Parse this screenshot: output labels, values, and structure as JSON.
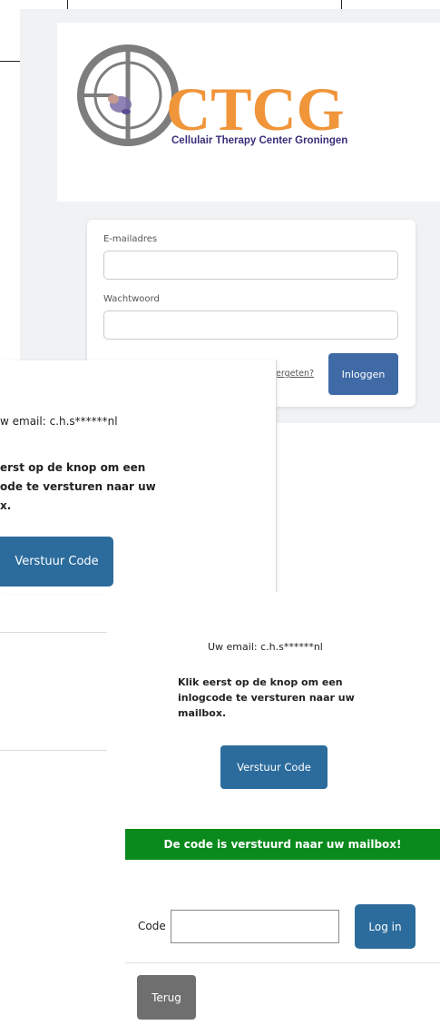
{
  "logo": {
    "brand_text": "CTCG",
    "tagline": "Cellulair Therapy Center Groningen",
    "colors": {
      "orange": "#f0953a",
      "purple": "#3b2f7a",
      "gray": "#7d7d7d"
    }
  },
  "login": {
    "email_label": "E-mailadres",
    "email_value": "",
    "password_label": "Wachtwoord",
    "password_value": "",
    "forgot_link": "ergeten?",
    "login_button": "Inloggen"
  },
  "step2": {
    "email_text": "w email: c.h.s******nl",
    "instruction_line1": "erst op de knop om een",
    "instruction_line2": "ode te versturen naar uw",
    "instruction_line3": "x.",
    "send_button": "Verstuur Code"
  },
  "step3": {
    "email_text": "Uw email: c.h.s******nl",
    "instruction_line1": "Klik eerst op de knop om een",
    "instruction_line2": "inlogcode te versturen naar uw",
    "instruction_line3": "mailbox.",
    "send_button": "Verstuur Code",
    "success_message": "De code is verstuurd naar uw mailbox!",
    "code_label": "Code",
    "code_value": "",
    "login_button": "Log in",
    "back_button": "Terug"
  },
  "colors": {
    "primary_blue": "#2b6c9d",
    "login_blue": "#3f6aa6",
    "success_green": "#0a8a1c",
    "back_gray": "#6f6f6f"
  }
}
